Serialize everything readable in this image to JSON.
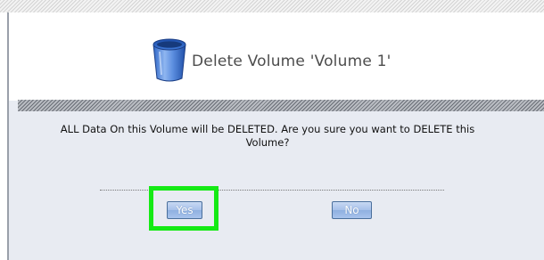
{
  "dialog": {
    "title": "Delete Volume 'Volume 1'",
    "icon": "trash-can-icon",
    "message": "ALL Data On this Volume will be DELETED. Are you sure you want to DELETE this Volume?",
    "buttons": {
      "yes_label": "Yes",
      "no_label": "No"
    }
  },
  "colors": {
    "highlight": "#15ea15",
    "panel_background": "#e8ebf2",
    "button_blue": "#a6c0e9"
  }
}
